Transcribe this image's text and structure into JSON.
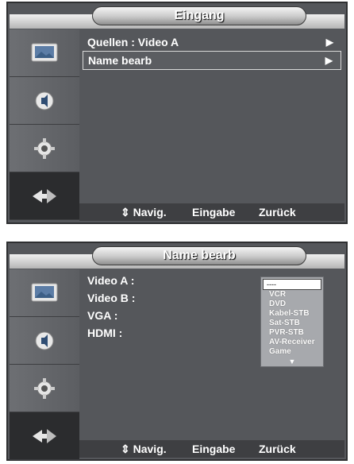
{
  "panel1": {
    "title": "Eingang",
    "rows": [
      {
        "label": "Quellen  :  Video A",
        "arrow": "▶"
      },
      {
        "label": "Name bearb",
        "arrow": "▶"
      }
    ],
    "footer": {
      "nav": "⇕ Navig.",
      "enter": "Eingabe",
      "back": "Zurück"
    }
  },
  "panel2": {
    "title": "Name bearb",
    "labels": [
      "Video A :",
      "Video B :",
      "VGA :",
      "HDMI :"
    ],
    "dropdown": {
      "selected": "----",
      "items": [
        "VCR",
        "DVD",
        "Kabel-STB",
        "Sat-STB",
        "PVR-STB",
        "AV-Receiver",
        "Game"
      ],
      "more": "▼"
    },
    "footer": {
      "nav": "⇕ Navig.",
      "enter": "Eingabe",
      "back": "Zurück"
    }
  },
  "sidebar_icons": [
    "picture-icon",
    "sound-icon",
    "setup-icon",
    "input-icon"
  ],
  "colors": {
    "panel_bg": "#55575b",
    "title_text": "#ffffff",
    "active_tab": "#2b2c2e"
  }
}
